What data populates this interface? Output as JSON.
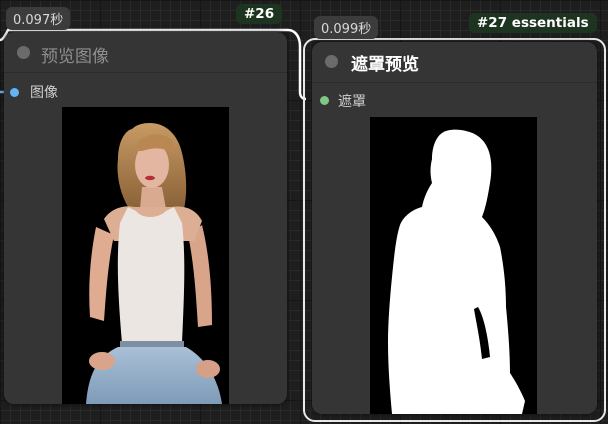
{
  "node26": {
    "exec_time": "0.097秒",
    "id": "#26",
    "title": "预览图像",
    "input_label": "图像",
    "preview_icon": "photo-preview-woman"
  },
  "node27": {
    "exec_time": "0.099秒",
    "id": "#27 essentials",
    "title": "遮罩预览",
    "input_label": "遮罩",
    "preview_icon": "mask-silhouette-preview"
  },
  "colors": {
    "image_slot": "#64b5f6",
    "mask_slot": "#81c784",
    "node_bg": "#353535",
    "id_badge_bg": "#1d3520"
  }
}
